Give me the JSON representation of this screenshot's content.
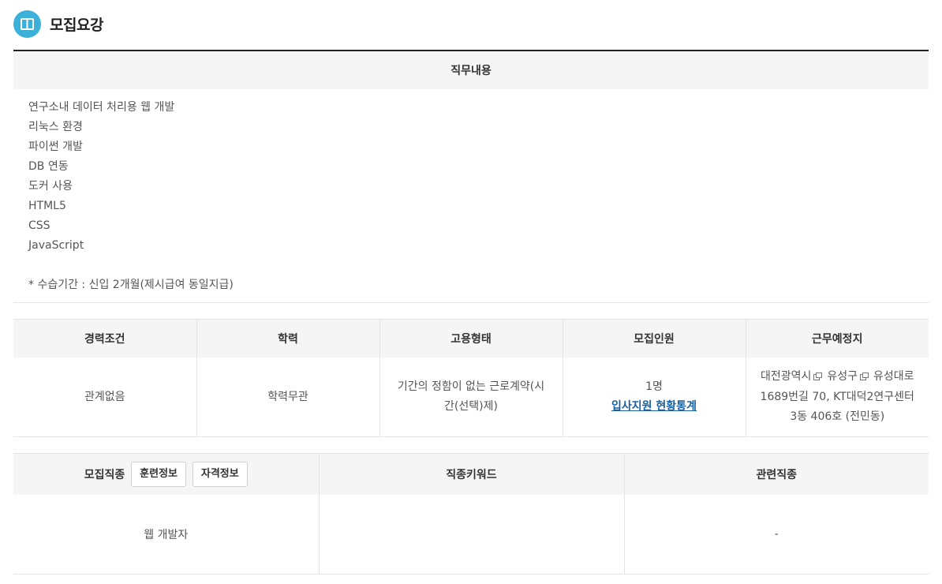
{
  "section": {
    "title": "모집요강",
    "icon": "book-icon"
  },
  "duty": {
    "header": "직무내용",
    "lines": [
      "연구소내 데이터 처리용 웹 개발",
      "리눅스 환경",
      "파이썬 개발",
      "DB 연동",
      "도커 사용",
      "HTML5",
      "CSS",
      "JavaScript"
    ],
    "note": "* 수습기간 : 신입 2개월(제시급여 동일지급)"
  },
  "conditions": {
    "headers": [
      "경력조건",
      "학력",
      "고용형태",
      "모집인원",
      "근무예정지"
    ],
    "experience": "관계없음",
    "education": "학력무관",
    "employment_type": "기간의 정함이 없는 근로계약(시간(선택)제)",
    "recruit_count": "1명",
    "applicant_stats_link": "입사지원 현황통계",
    "location": {
      "city": "대전광역시",
      "district": "유성구",
      "address": "유성대로1689번길 70, KT대덕2연구센터 3동 406호 (전민동)"
    }
  },
  "job": {
    "headers": {
      "occupation": "모집직종",
      "keywords": "직종키워드",
      "related": "관련직종"
    },
    "buttons": {
      "training": "훈련정보",
      "certification": "자격정보"
    },
    "occupation": "웹 개발자",
    "keywords": "",
    "related": "-"
  },
  "colors": {
    "accent": "#3bb0d9",
    "link": "#1a5fa0",
    "header_bg": "#f5f5f5",
    "border": "#e4e4e4"
  }
}
